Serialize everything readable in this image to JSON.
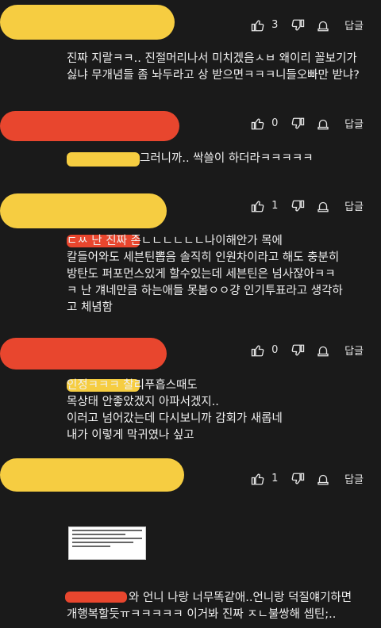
{
  "comments": [
    {
      "likes": "3",
      "reply": "답글",
      "text": "진짜 지랄ㅋㅋ.. 진절머리나서 미치겠음ㅅㅂ 왜이리 꼴보기가\n싫냐 무개념들 좀 놔두라고 상 받으면ㅋㅋㅋ니들오빠만 받냐?"
    },
    {
      "likes": "0",
      "reply": "답글",
      "text": "그러니까.. 싹쓸이 하더라ㅋㅋㅋㅋㅋ"
    },
    {
      "likes": "1",
      "reply": "답글",
      "text": "ㄷㅆ 난 진짜 존ㄴㄴㄴㄴㄴㄴ나이해안가 목에\n칼들어와도 세븐틴뽑음 솔직히 인원차이라고 해도 충분히\n방탄도 퍼포먼스있게 할수있는데 세븐틴은 넘사잖아ㅋㅋ\nㅋ 난 걔네만큼 하는애들 못봄ㅇㅇ걍 인기투표라고 생각하\n고 체념함"
    },
    {
      "likes": "0",
      "reply": "답글",
      "text": "인정ㅋㅋㅋ 찰리푸흡스때도\n목상태 안좋았겠지 아파서겠지..\n이러고 넘어갔는데 다시보니까 감회가 새롭네\n내가 이렇게 막귀였나 싶고"
    },
    {
      "likes": "1",
      "reply": "답글",
      "text": "와 언니 나랑 너무똑같애..언니랑 덕질얘기하면\n개행복할듯ㅠㅋㅋㅋㅋㅋ 이거봐 진짜 ㅈㄴ불쌍해 셉틴;.."
    }
  ]
}
